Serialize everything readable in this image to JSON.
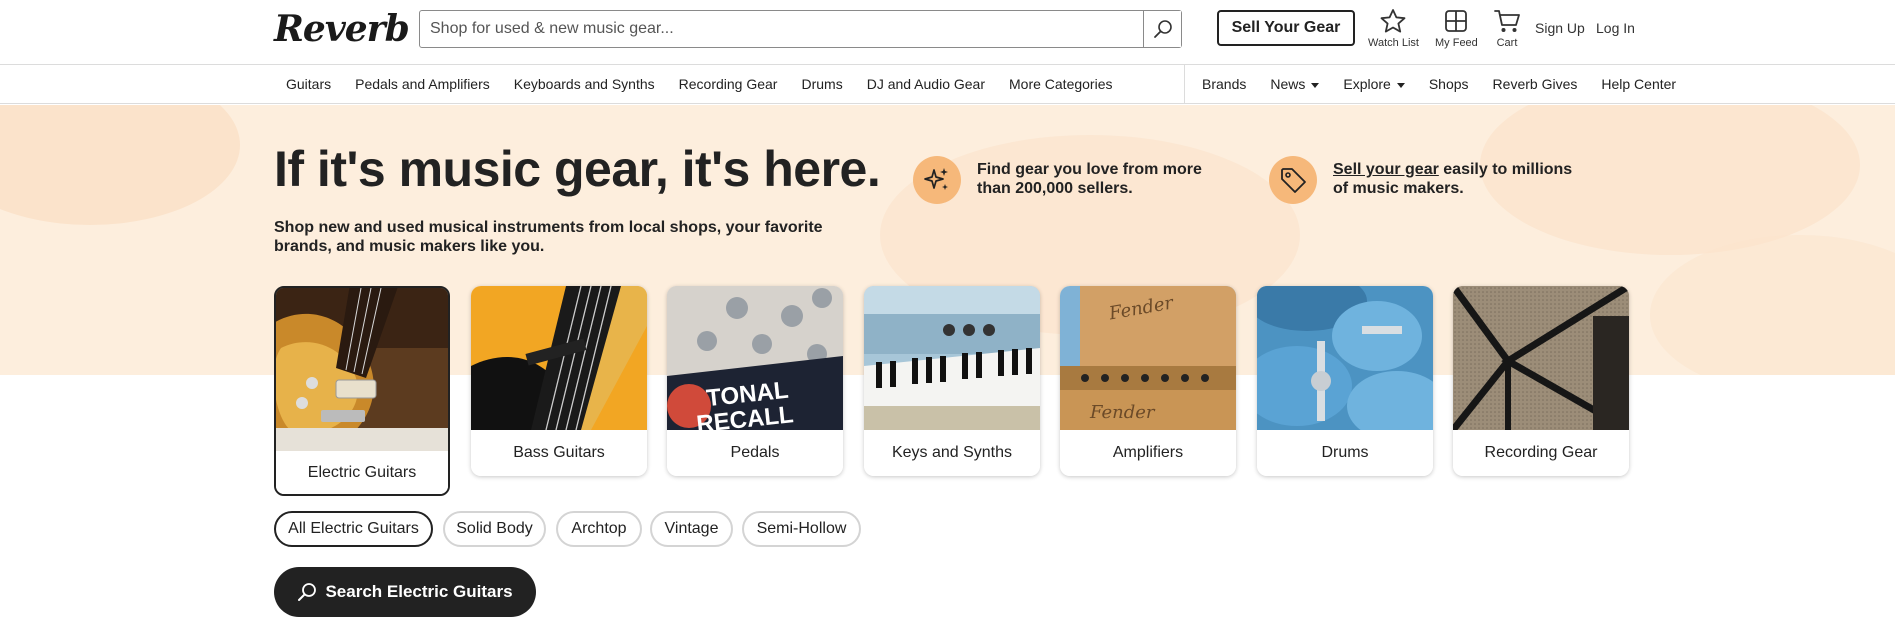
{
  "header": {
    "logo": "Reverb",
    "search_placeholder": "Shop for used & new music gear...",
    "sell_button": "Sell Your Gear",
    "watch_list": "Watch List",
    "my_feed": "My Feed",
    "cart": "Cart",
    "sign_up": "Sign Up",
    "log_in": "Log In"
  },
  "nav": {
    "left": [
      "Guitars",
      "Pedals and Amplifiers",
      "Keyboards and Synths",
      "Recording Gear",
      "Drums",
      "DJ and Audio Gear",
      "More Categories"
    ],
    "right": {
      "brands": "Brands",
      "news": "News",
      "explore": "Explore",
      "shops": "Shops",
      "reverb_gives": "Reverb Gives",
      "help_center": "Help Center"
    }
  },
  "hero": {
    "title": "If it's music gear, it's here.",
    "subtitle": "Shop new and used musical instruments from local shops, your favorite brands, and music makers like you.",
    "feature1": "Find gear you love from more than 200,000 sellers.",
    "feature2_link": "Sell your gear",
    "feature2_rest": " easily to millions of music makers."
  },
  "categories": [
    "Electric Guitars",
    "Bass Guitars",
    "Pedals",
    "Keys and Synths",
    "Amplifiers",
    "Drums",
    "Recording Gear"
  ],
  "pedal_text_line1": "TONAL",
  "pedal_text_line2": "RECALL",
  "amp_brand": "Fender",
  "subcategories": [
    "All Electric Guitars",
    "Solid Body",
    "Archtop",
    "Vintage",
    "Semi-Hollow"
  ],
  "search_category_button": "Search Electric Guitars",
  "colors": {
    "hero_bg": "#fdeedd",
    "accent_orange": "#f6b87a",
    "dark": "#222222"
  }
}
